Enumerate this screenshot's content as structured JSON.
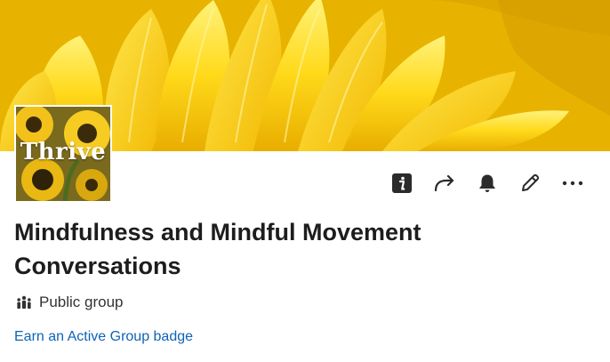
{
  "group": {
    "logo_text": "Thrive",
    "title": "Mindfulness and Mindful Movement Conversations",
    "privacy_label": "Public group",
    "badge_link": "Earn an Active Group badge"
  },
  "actions": [
    {
      "name": "info-button",
      "icon": "info-icon"
    },
    {
      "name": "share-button",
      "icon": "share-arrow-icon"
    },
    {
      "name": "notifications-button",
      "icon": "bell-icon"
    },
    {
      "name": "edit-button",
      "icon": "pencil-icon"
    },
    {
      "name": "more-button",
      "icon": "ellipsis-icon"
    }
  ],
  "colors": {
    "cover_yellow": "#f7c400",
    "link_blue": "#0f63b6",
    "icon_dark": "#2b2b2b",
    "text_dark": "#1d1d1d"
  }
}
